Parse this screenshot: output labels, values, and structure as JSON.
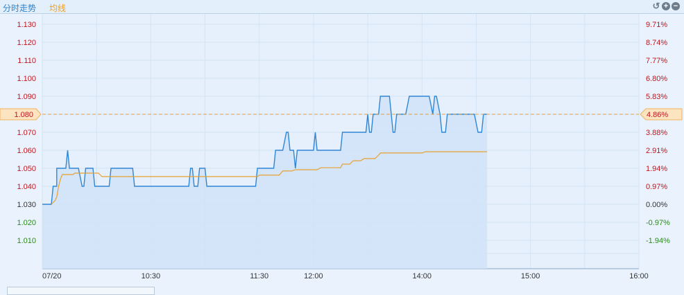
{
  "header": {
    "tab_main": "分时走势",
    "tab_avg": "均线",
    "tools": [
      "undo-icon",
      "zoom-in-icon",
      "zoom-out-icon"
    ]
  },
  "colors": {
    "price": "#2f86d6",
    "avg": "#e8a030",
    "up": "#c0141c",
    "down": "#2a8a1a",
    "neutral": "#333333",
    "grid": "#d3e4f4",
    "fill": "#cfe2f8"
  },
  "chart_data": {
    "type": "line",
    "title": "分时走势",
    "prev_close": 1.03,
    "current_price_label": "1.080",
    "current_pct_label": "4.86%",
    "current_price": 1.08,
    "ylim": [
      0.994,
      1.136
    ],
    "y_ticks": [
      "1.130",
      "1.120",
      "1.110",
      "1.100",
      "1.090",
      "1.080",
      "1.070",
      "1.060",
      "1.050",
      "1.040",
      "1.030",
      "1.020",
      "1.010"
    ],
    "y_tick_values": [
      1.13,
      1.12,
      1.11,
      1.1,
      1.09,
      1.08,
      1.07,
      1.06,
      1.05,
      1.04,
      1.03,
      1.02,
      1.01
    ],
    "pct_ticks": [
      "9.71%",
      "8.74%",
      "7.77%",
      "6.80%",
      "5.83%",
      "4.86%",
      "3.88%",
      "2.91%",
      "1.94%",
      "0.97%",
      "0.00%",
      "-0.97%",
      "-1.94%"
    ],
    "x_range_minutes": [
      0,
      330
    ],
    "x_ticks": [
      {
        "label": "07/20",
        "minute": 0
      },
      {
        "label": "10:30",
        "minute": 60
      },
      {
        "label": "11:30",
        "minute": 120
      },
      {
        "label": "12:00",
        "minute": 150
      },
      {
        "label": "14:00",
        "minute": 210
      },
      {
        "label": "15:00",
        "minute": 270
      },
      {
        "label": "16:00",
        "minute": 330
      }
    ],
    "grid_minutes": [
      0,
      30,
      60,
      90,
      120,
      150,
      180,
      210,
      240,
      270,
      300,
      330
    ],
    "series": [
      {
        "name": "price",
        "points": [
          [
            0,
            1.03
          ],
          [
            5,
            1.03
          ],
          [
            6,
            1.04
          ],
          [
            8,
            1.04
          ],
          [
            8,
            1.05
          ],
          [
            13,
            1.05
          ],
          [
            14,
            1.06
          ],
          [
            15,
            1.05
          ],
          [
            20,
            1.05
          ],
          [
            22,
            1.04
          ],
          [
            23,
            1.04
          ],
          [
            24,
            1.05
          ],
          [
            28,
            1.05
          ],
          [
            29,
            1.04
          ],
          [
            37,
            1.04
          ],
          [
            38,
            1.05
          ],
          [
            50,
            1.05
          ],
          [
            51,
            1.04
          ],
          [
            81,
            1.04
          ],
          [
            82,
            1.05
          ],
          [
            83,
            1.05
          ],
          [
            84,
            1.04
          ],
          [
            86,
            1.04
          ],
          [
            87,
            1.05
          ],
          [
            90,
            1.05
          ],
          [
            91,
            1.04
          ],
          [
            118,
            1.04
          ],
          [
            119,
            1.05
          ],
          [
            128,
            1.05
          ],
          [
            129,
            1.06
          ],
          [
            133,
            1.06
          ],
          [
            135,
            1.07
          ],
          [
            136,
            1.07
          ],
          [
            137,
            1.06
          ],
          [
            139,
            1.06
          ],
          [
            140,
            1.05
          ],
          [
            141,
            1.06
          ],
          [
            150,
            1.06
          ],
          [
            151,
            1.07
          ],
          [
            152,
            1.06
          ],
          [
            165,
            1.06
          ],
          [
            166,
            1.07
          ],
          [
            179,
            1.07
          ],
          [
            180,
            1.08
          ],
          [
            181,
            1.07
          ],
          [
            182,
            1.07
          ],
          [
            183,
            1.08
          ],
          [
            186,
            1.08
          ],
          [
            187,
            1.09
          ],
          [
            192,
            1.09
          ],
          [
            193,
            1.08
          ],
          [
            194,
            1.07
          ],
          [
            195,
            1.07
          ],
          [
            196,
            1.08
          ],
          [
            201,
            1.08
          ],
          [
            203,
            1.09
          ],
          [
            214,
            1.09
          ],
          [
            216,
            1.08
          ],
          [
            217,
            1.09
          ],
          [
            218,
            1.09
          ],
          [
            220,
            1.08
          ],
          [
            221,
            1.07
          ],
          [
            223,
            1.07
          ],
          [
            224,
            1.08
          ],
          [
            239,
            1.08
          ],
          [
            241,
            1.07
          ],
          [
            243,
            1.07
          ],
          [
            244,
            1.08
          ],
          [
            246,
            1.08
          ]
        ]
      },
      {
        "name": "均线",
        "points": [
          [
            5,
            1.03
          ],
          [
            7,
            1.032
          ],
          [
            8,
            1.034
          ],
          [
            9,
            1.04
          ],
          [
            10,
            1.044
          ],
          [
            11,
            1.0465
          ],
          [
            17,
            1.0465
          ],
          [
            18,
            1.0473
          ],
          [
            31,
            1.0473
          ],
          [
            33,
            1.0454
          ],
          [
            119,
            1.0454
          ],
          [
            120,
            1.0462
          ],
          [
            131,
            1.0462
          ],
          [
            133,
            1.0485
          ],
          [
            138,
            1.0485
          ],
          [
            140,
            1.0492
          ],
          [
            152,
            1.0492
          ],
          [
            154,
            1.0503
          ],
          [
            165,
            1.0503
          ],
          [
            166,
            1.0523
          ],
          [
            170,
            1.0523
          ],
          [
            172,
            1.0542
          ],
          [
            176,
            1.0542
          ],
          [
            178,
            1.0554
          ],
          [
            184,
            1.0554
          ],
          [
            186,
            1.0573
          ],
          [
            187,
            1.0585
          ],
          [
            210,
            1.0585
          ],
          [
            212,
            1.0592
          ],
          [
            246,
            1.0592
          ]
        ]
      }
    ]
  }
}
